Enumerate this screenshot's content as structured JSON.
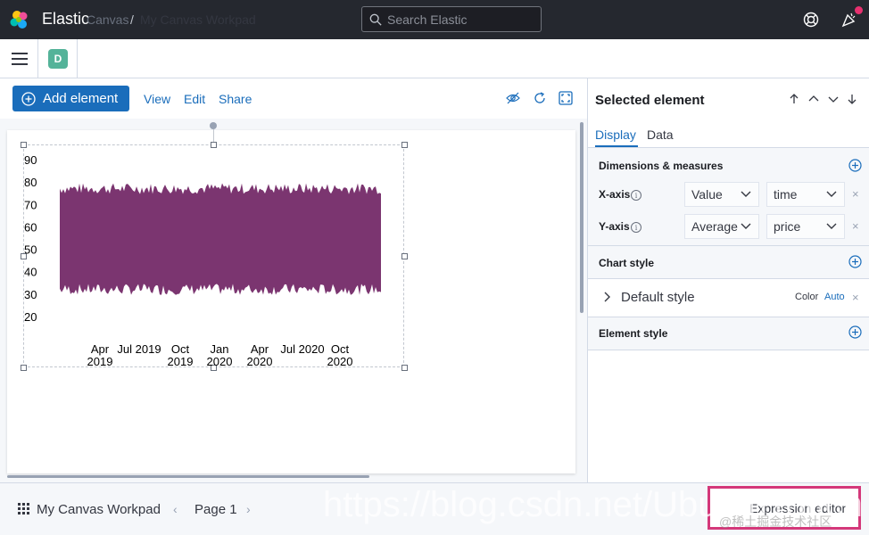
{
  "header": {
    "brand": "Elastic",
    "search_placeholder": "Search Elastic"
  },
  "breadcrumb": {
    "space_initial": "D",
    "items": [
      "Canvas",
      "My Canvas Workpad"
    ],
    "separator": "/"
  },
  "toolbar": {
    "add_element": "Add element",
    "view": "View",
    "edit": "Edit",
    "share": "Share"
  },
  "panel": {
    "title": "Selected element",
    "tabs": [
      "Display",
      "Data"
    ],
    "dimensions_label": "Dimensions & measures",
    "x_axis": {
      "label": "X-axis",
      "function": "Value",
      "field": "time"
    },
    "y_axis": {
      "label": "Y-axis",
      "function": "Average",
      "field": "price"
    },
    "chart_style_label": "Chart style",
    "default_style_label": "Default style",
    "color_label": "Color",
    "color_value": "Auto",
    "element_style_label": "Element style"
  },
  "chart_data": {
    "type": "area",
    "series_color": "#7b3570",
    "y_ticks": [
      "90",
      "80",
      "70",
      "60",
      "50",
      "40",
      "30",
      "20"
    ],
    "x_ticks": [
      [
        "Apr",
        "2019"
      ],
      [
        "Jul 2019",
        ""
      ],
      [
        "Oct",
        "2019"
      ],
      [
        "Jan",
        "2020"
      ],
      [
        "Apr",
        "2020"
      ],
      [
        "Jul 2020",
        ""
      ],
      [
        "Oct",
        "2020"
      ]
    ],
    "ylim": [
      20,
      90
    ],
    "band_low": [
      30,
      35
    ],
    "band_high": [
      75,
      80
    ]
  },
  "footer": {
    "workpad_title": "My Canvas Workpad",
    "page_label": "Page 1",
    "expression_editor": "Expression editor"
  },
  "watermark": {
    "url": "https://blog.csdn.net/UbuntuTouch",
    "community": "@稀土掘金技术社区"
  },
  "colors": {
    "primary": "#1a6dbb",
    "header_bg": "#25282f",
    "highlight": "#d4387a"
  }
}
